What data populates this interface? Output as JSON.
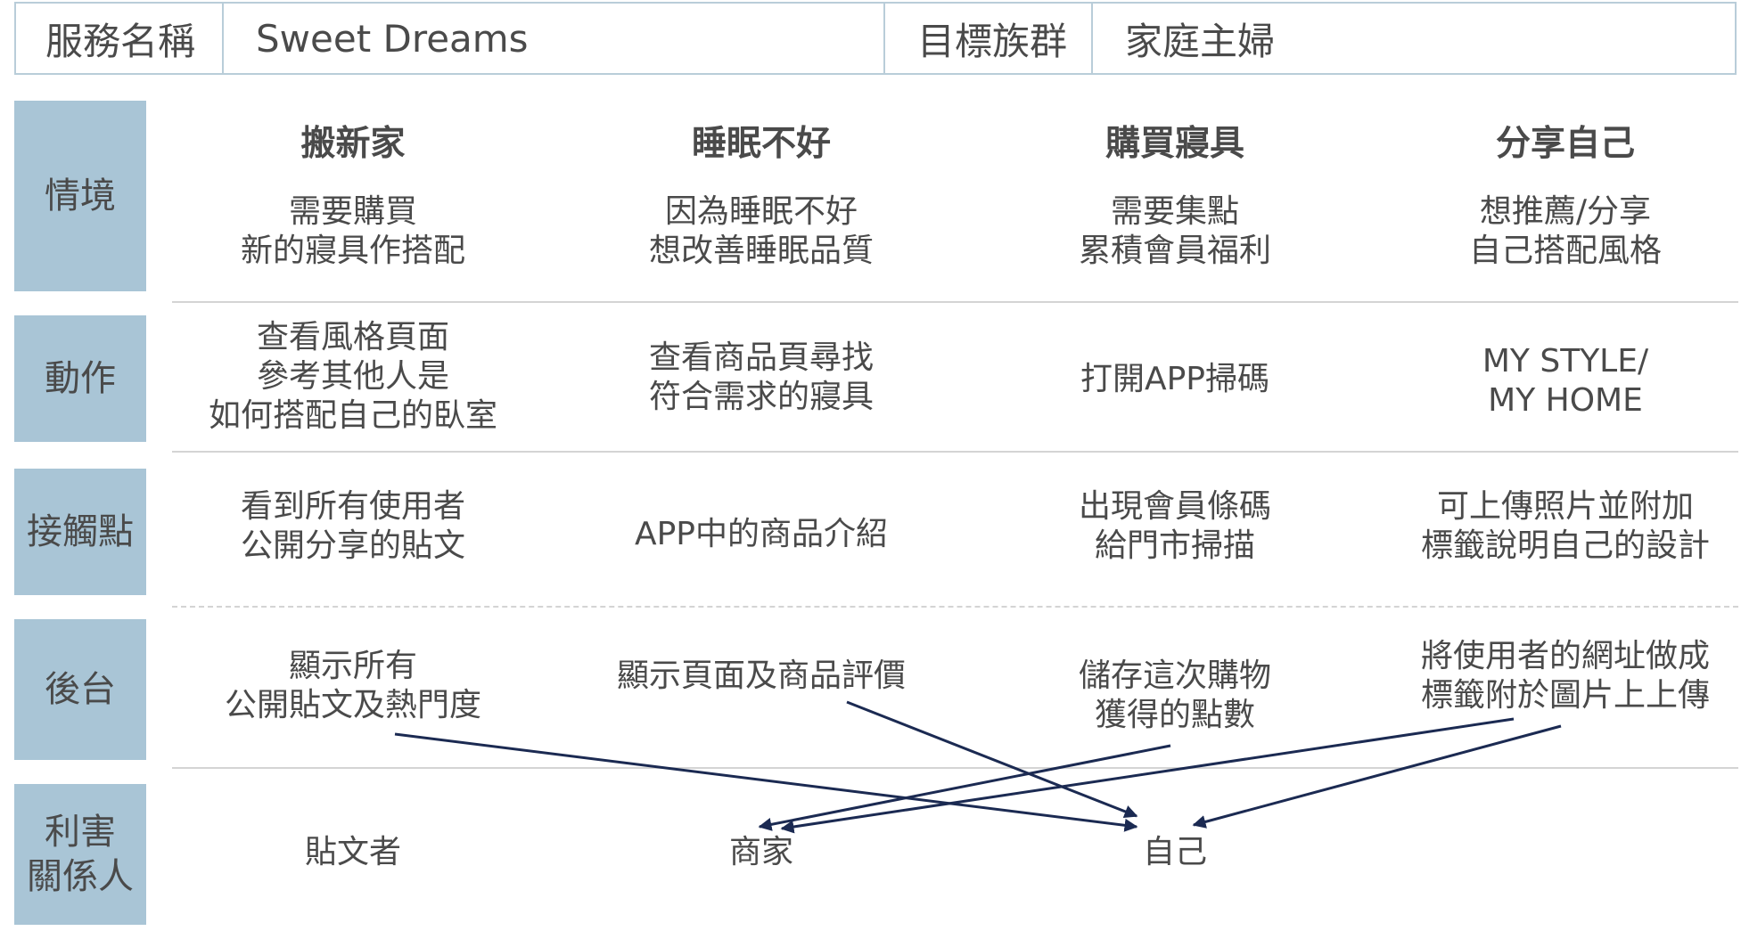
{
  "header": {
    "service_label": "服務名稱",
    "service_value": "Sweet Dreams",
    "target_label": "目標族群",
    "target_value": "家庭主婦"
  },
  "rows": {
    "scenario": "情境",
    "action": "動作",
    "touchpoint": "接觸點",
    "backend": "後台",
    "stakeholder": [
      "利害",
      "關係人"
    ]
  },
  "columns": [
    {
      "title": "搬新家",
      "scenario": [
        "需要購買",
        "新的寢具作搭配"
      ],
      "action": [
        "查看風格頁面",
        "參考其他人是",
        "如何搭配自己的臥室"
      ],
      "touchpoint": [
        "看到所有使用者",
        "公開分享的貼文"
      ],
      "backend": [
        "顯示所有",
        "公開貼文及熱門度"
      ],
      "stakeholder": "貼文者"
    },
    {
      "title": "睡眠不好",
      "scenario": [
        "因為睡眠不好",
        "想改善睡眠品質"
      ],
      "action": [
        "查看商品頁尋找",
        "符合需求的寢具"
      ],
      "touchpoint": [
        "APP中的商品介紹"
      ],
      "backend": [
        "顯示頁面及商品評價"
      ],
      "stakeholder": "商家"
    },
    {
      "title": "購買寢具",
      "scenario": [
        "需要集點",
        "累積會員福利"
      ],
      "action": [
        "打開APP掃碼"
      ],
      "touchpoint": [
        "出現會員條碼",
        "給門市掃描"
      ],
      "backend": [
        "儲存這次購物",
        "獲得的點數"
      ],
      "stakeholder": "自己"
    },
    {
      "title": "分享自己",
      "scenario": [
        "想推薦/分享",
        "自己搭配風格"
      ],
      "action": [
        "MY STYLE/",
        "MY HOME"
      ],
      "touchpoint": [
        "可上傳照片並附加",
        "標籤說明自己的設計"
      ],
      "backend": [
        "將使用者的網址做成",
        "標籤附於圖片上上傳"
      ],
      "stakeholder": ""
    }
  ],
  "arrows": [
    {
      "from": "顯示所有公開貼文及熱門度",
      "to": "自己"
    },
    {
      "from": "顯示頁面及商品評價",
      "to": "自己"
    },
    {
      "from": "儲存這次購物獲得的點數",
      "to": "商家"
    },
    {
      "from": "將使用者的網址做成標籤附於圖片上上傳",
      "to": "商家"
    },
    {
      "from": "將使用者的網址做成標籤附於圖片上上傳",
      "to": "自己"
    }
  ],
  "colors": {
    "label_bg": "#a9c5d6",
    "header_border": "#b9cdd9",
    "arrow": "#1b2a52",
    "text": "#4a4a4a"
  }
}
